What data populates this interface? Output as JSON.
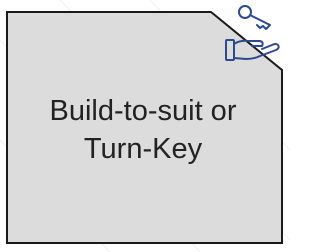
{
  "card": {
    "label_line1": "Build-to-suit or",
    "label_line2": "Turn-Key",
    "fill_color": "#dcdcdd",
    "border_color": "#1a1a1a",
    "icon_color": "#2e4a8f"
  },
  "icons": [
    "key-icon",
    "hand-icon"
  ]
}
